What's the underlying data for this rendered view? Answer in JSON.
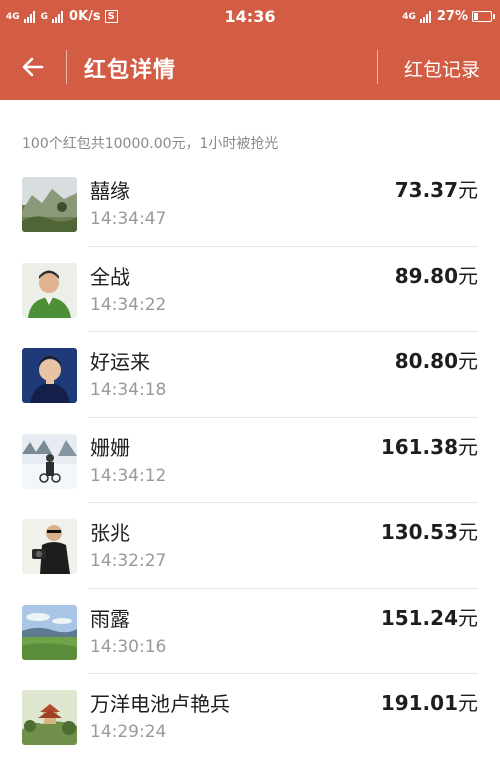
{
  "status_bar": {
    "net1": "4G",
    "net2": "G",
    "speed": "0K/s",
    "boxed_icon": "S",
    "time": "14:36",
    "net3": "4G",
    "battery": "27%",
    "battery_level": 0.27
  },
  "app_bar": {
    "title": "红包详情",
    "records_label": "红包记录",
    "back_icon": "arrow-left-icon",
    "background": "#d35c45"
  },
  "summary": "100个红包共10000.00元，1小时被抢光",
  "currency_unit": "元",
  "entries": [
    {
      "name": "囍缘",
      "time": "14:34:47",
      "amount": "73.37",
      "avatar": "landscape-rocks"
    },
    {
      "name": "全战",
      "time": "14:34:22",
      "amount": "89.80",
      "avatar": "man-green-shirt"
    },
    {
      "name": "好运来",
      "time": "14:34:18",
      "amount": "80.80",
      "avatar": "man-portrait"
    },
    {
      "name": "姗姗",
      "time": "14:34:12",
      "amount": "161.38",
      "avatar": "snow-scene"
    },
    {
      "name": "张兆",
      "time": "14:32:27",
      "amount": "130.53",
      "avatar": "man-with-camera"
    },
    {
      "name": "雨露",
      "time": "14:30:16",
      "amount": "151.24",
      "avatar": "grassland-sky"
    },
    {
      "name": "万洋电池卢艳兵",
      "time": "14:29:24",
      "amount": "191.01",
      "avatar": "pavilion-landscape"
    }
  ]
}
